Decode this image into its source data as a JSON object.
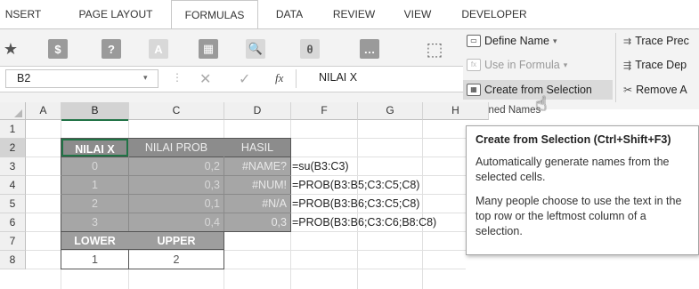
{
  "tabs": [
    {
      "label": "NSERT",
      "active": false
    },
    {
      "label": "PAGE LAYOUT",
      "active": false
    },
    {
      "label": "FORMULAS",
      "active": true
    },
    {
      "label": "DATA",
      "active": false
    },
    {
      "label": "REVIEW",
      "active": false
    },
    {
      "label": "VIEW",
      "active": false
    },
    {
      "label": "DEVELOPER",
      "active": false
    }
  ],
  "defined_names": {
    "define_name": "Define Name",
    "use_in_formula": "Use in Formula",
    "create_from_selection": "Create from Selection",
    "group_label": "Defined Names"
  },
  "auditing": {
    "trace_precedents": "Trace Prec",
    "trace_dependents": "Trace Dep",
    "remove_arrows": "Remove A"
  },
  "formula_bar": {
    "name_box": "B2",
    "fx": "fx",
    "content": "NILAI X"
  },
  "columns": [
    "A",
    "B",
    "C",
    "D",
    "F",
    "G",
    "H"
  ],
  "rows": [
    "1",
    "2",
    "3",
    "4",
    "5",
    "6",
    "7",
    "8"
  ],
  "table": {
    "headers": [
      "NILAI X",
      "NILAI PROB",
      "HASIL"
    ],
    "rows": [
      [
        "0",
        "0,2",
        "#NAME?"
      ],
      [
        "1",
        "0,3",
        "#NUM!"
      ],
      [
        "2",
        "0,1",
        "#N/A"
      ],
      [
        "3",
        "0,4",
        "0,3"
      ]
    ]
  },
  "formulas": [
    "=su(B3:C3)",
    "=PROB(B3:B5;C3:C5;C8)",
    "=PROB(B3:B6;C3:C5;C8)",
    "=PROB(B3:B6;C3:C6;B8:C8)"
  ],
  "limits": {
    "headers": [
      "LOWER",
      "UPPER"
    ],
    "values": [
      "1",
      "2"
    ]
  },
  "tooltip": {
    "title": "Create from Selection (Ctrl+Shift+F3)",
    "line1": "Automatically generate names from the selected cells.",
    "line2": "Many people choose to use the text in the top row or the leftmost column of a selection."
  },
  "colors": {
    "header_fill": "#8c8c8c",
    "body_fill": "#a6a6a6",
    "limit_header_fill": "#9e9e9e",
    "accent": "#217346"
  }
}
